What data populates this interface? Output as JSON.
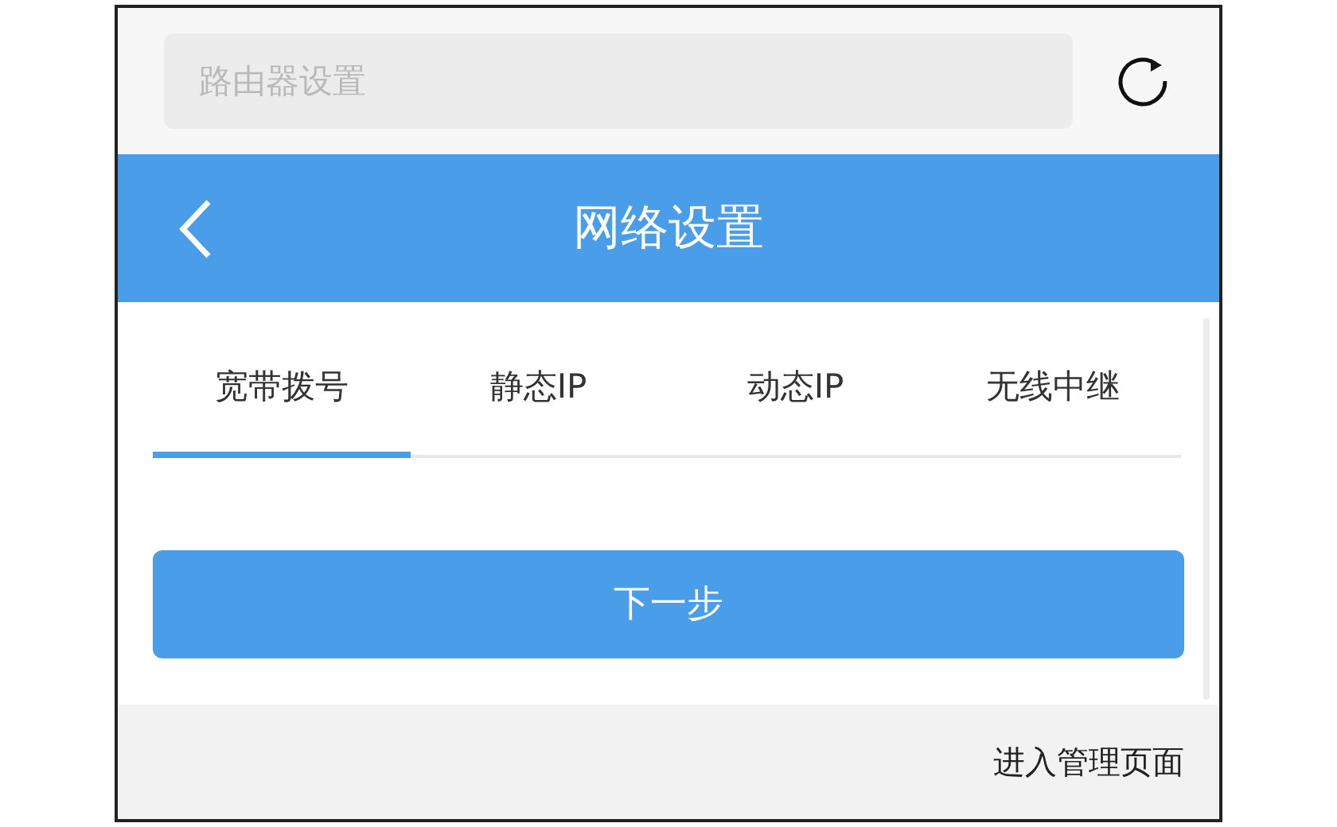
{
  "search": {
    "placeholder": "路由器设置"
  },
  "header": {
    "title": "网络设置"
  },
  "tabs": [
    {
      "label": "宽带拨号",
      "selected": true
    },
    {
      "label": "静态IP",
      "selected": false
    },
    {
      "label": "动态IP",
      "selected": false
    },
    {
      "label": "无线中继",
      "selected": false
    }
  ],
  "next_button": "下一步",
  "footer_link": "进入管理页面"
}
